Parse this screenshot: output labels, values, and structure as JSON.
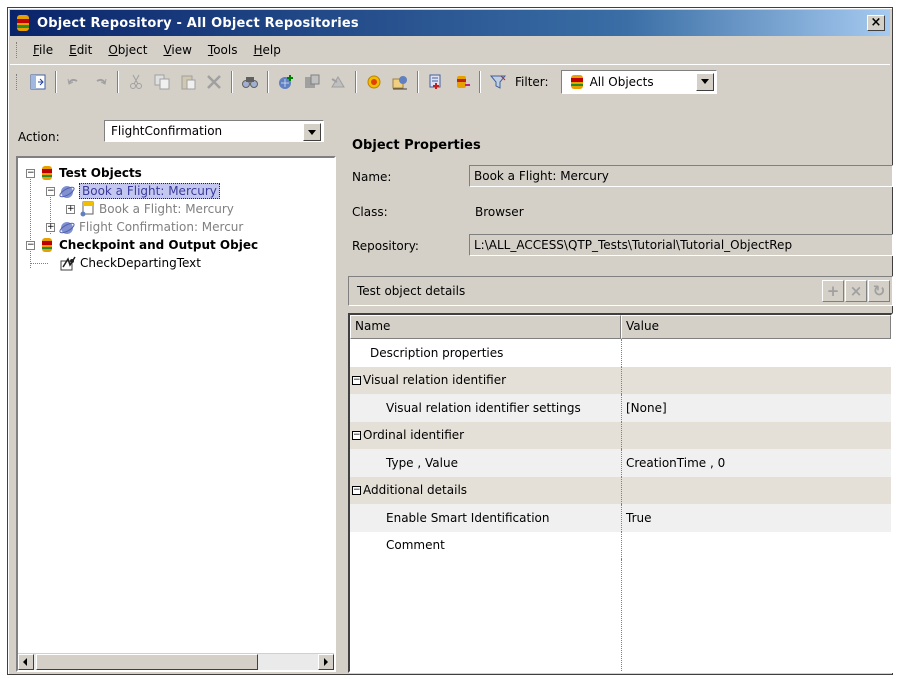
{
  "window": {
    "title": "Object Repository - All Object Repositories",
    "close_glyph": "×"
  },
  "menu": [
    "File",
    "Edit",
    "Object",
    "View",
    "Tools",
    "Help"
  ],
  "menu_mnemonics": [
    "F",
    "E",
    "O",
    "V",
    "T",
    "H"
  ],
  "toolbar": {
    "icons": [
      "locate-in-repository-icon",
      "undo-icon",
      "redo-icon",
      "cut-icon",
      "copy-icon",
      "paste-icon",
      "delete-icon",
      "find-icon",
      "add-objects-icon",
      "object-spy-icon",
      "highlight-icon",
      "checkpoint-icon",
      "define-new-icon",
      "associate-repository-icon",
      "export-icon"
    ],
    "filter_label": "Filter:",
    "filter_value": "All Objects"
  },
  "action": {
    "label": "Action:",
    "value": "FlightConfirmation"
  },
  "tree": {
    "nodes": [
      {
        "label": "Test Objects",
        "expander": "−",
        "icon": "repository-icon"
      },
      {
        "label": "Book a Flight: Mercury",
        "expander": "−",
        "icon": "browser-icon"
      },
      {
        "label": "Book a Flight: Mercury",
        "expander": "+",
        "icon": "page-icon"
      },
      {
        "label": "Flight Confirmation: Mercur",
        "expander": "+",
        "icon": "browser-icon"
      },
      {
        "label": "Checkpoint and Output Objec",
        "expander": "−",
        "icon": "repository-icon"
      },
      {
        "label": "CheckDepartingText",
        "expander": "",
        "icon": "text-checkpoint-icon"
      }
    ]
  },
  "properties": {
    "title": "Object Properties",
    "name_label": "Name:",
    "name_value": "Book a Flight: Mercury",
    "class_label": "Class:",
    "class_value": "Browser",
    "repository_label": "Repository:",
    "repository_value": "L:\\ALL_ACCESS\\QTP_Tests\\Tutorial\\Tutorial_ObjectRep"
  },
  "details": {
    "header": "Test object details",
    "buttons": [
      "+",
      "×",
      "↻"
    ],
    "columns": [
      "Name",
      "Value"
    ],
    "rows": [
      {
        "type": "plain",
        "name": "Description properties",
        "value": ""
      },
      {
        "type": "cat",
        "toggle": "−",
        "name": "Visual relation identifier",
        "value": ""
      },
      {
        "type": "prop",
        "name": "Visual relation identifier settings",
        "value": "[None]"
      },
      {
        "type": "cat",
        "toggle": "−",
        "name": "Ordinal identifier",
        "value": ""
      },
      {
        "type": "prop",
        "name": "Type , Value",
        "value": "CreationTime , 0"
      },
      {
        "type": "cat",
        "toggle": "−",
        "name": "Additional details",
        "value": ""
      },
      {
        "type": "prop",
        "name": "Enable Smart Identification",
        "value": "True"
      },
      {
        "type": "plain",
        "name": "Comment",
        "value": ""
      }
    ]
  }
}
